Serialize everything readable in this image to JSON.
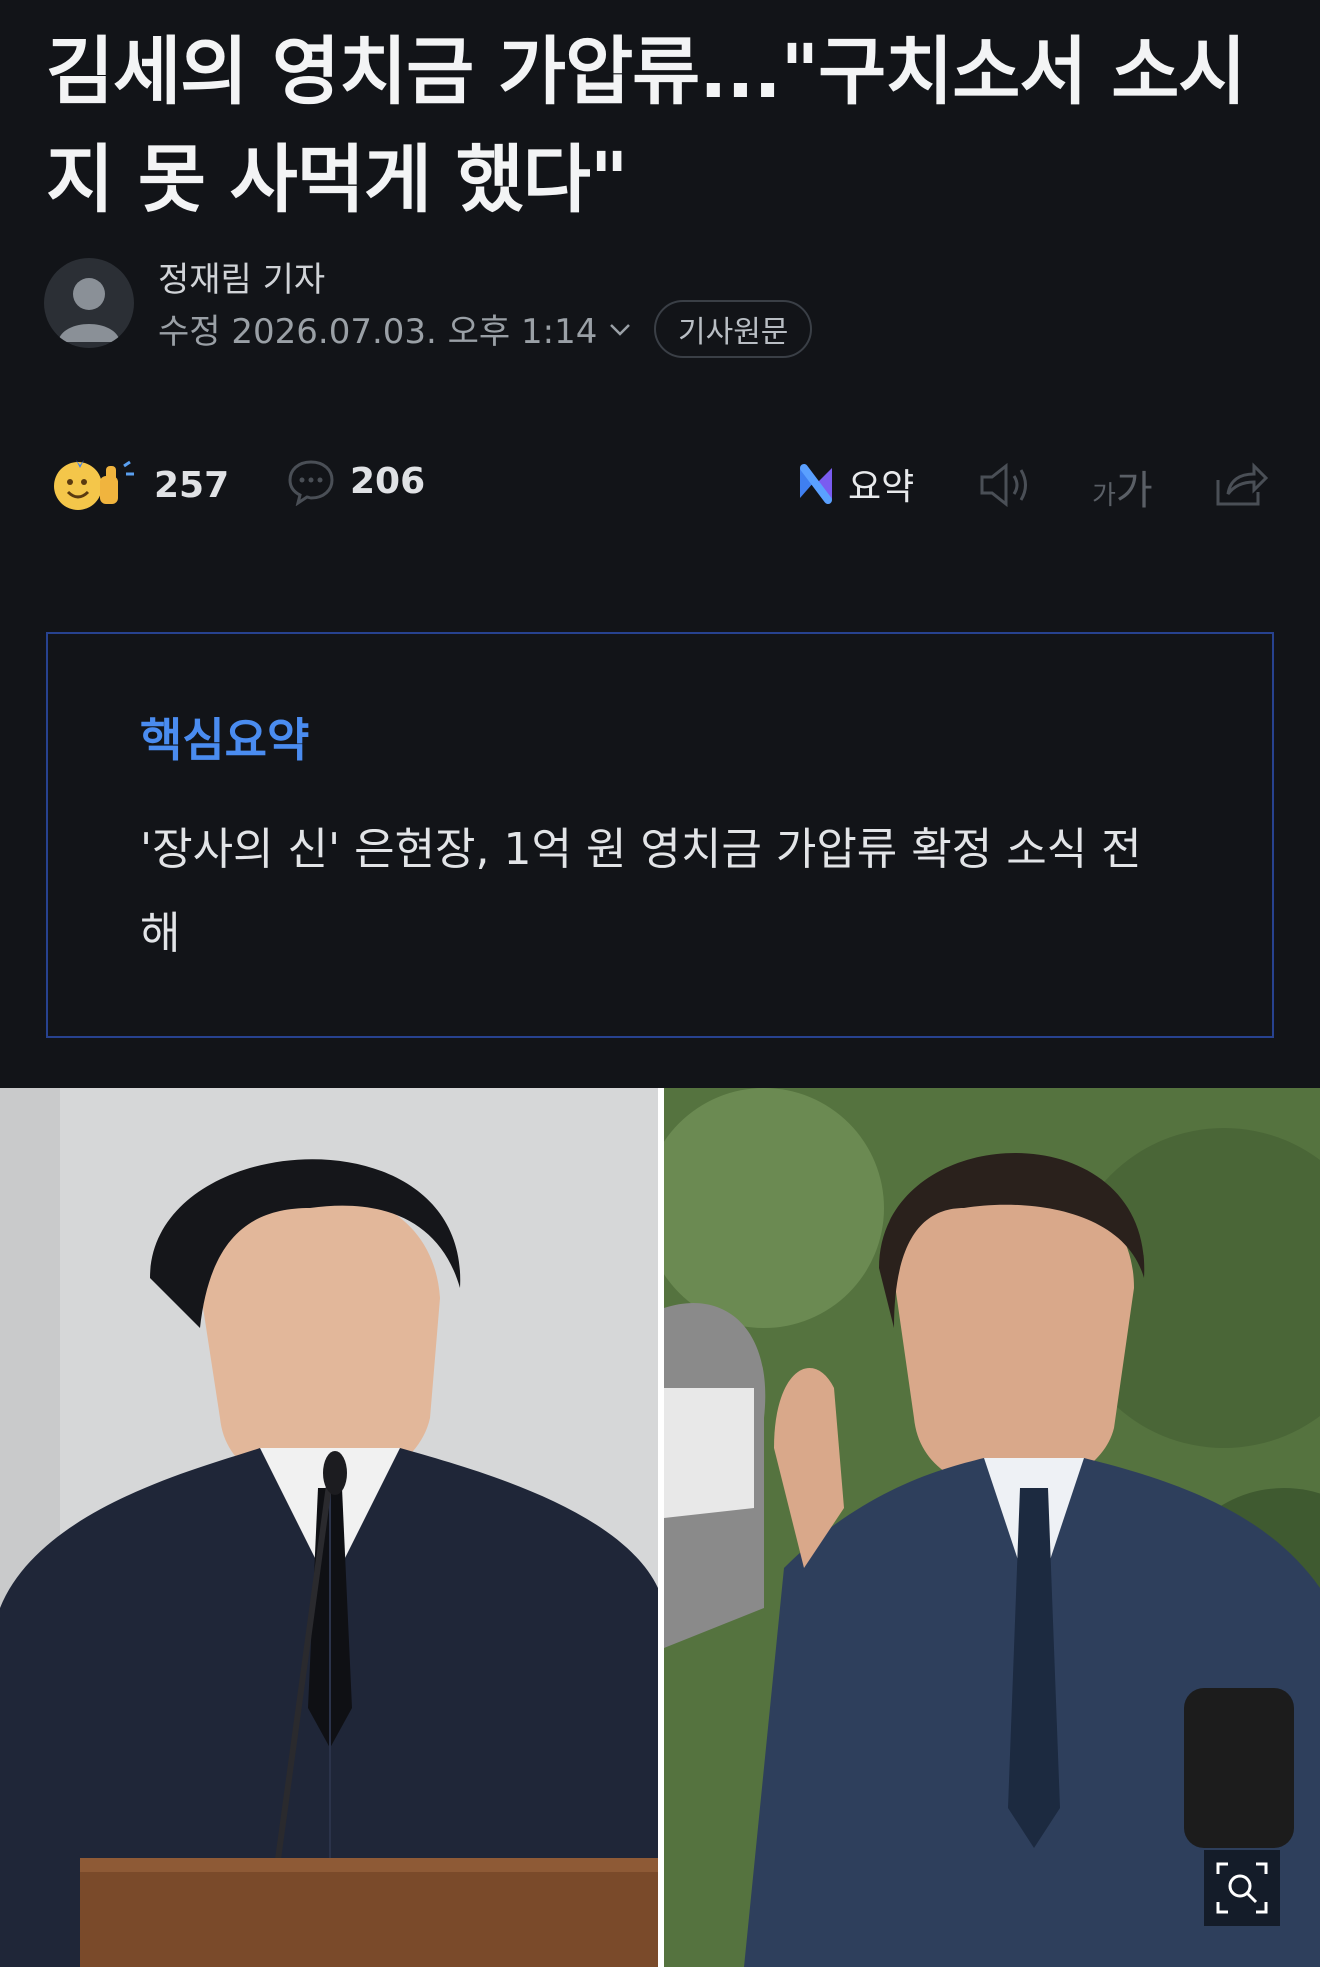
{
  "article": {
    "headline": "김세의 영치금 가압류...\"구치소서 소시지 못 사먹게 했다\"",
    "reporter": "정재림 기자",
    "date_label": "수정 2026.07.03. 오후 1:14",
    "original_button": "기사원문"
  },
  "toolbar": {
    "reaction_count": "257",
    "comment_count": "206",
    "summary_label": "요약",
    "font_label_small": "가",
    "font_label_large": "가"
  },
  "summary": {
    "title": "핵심요약",
    "text": "'장사의 신' 은현장, 1억 원 영치금 가압류 확정 소식 전해"
  },
  "colors": {
    "background": "#121418",
    "accent_blue": "#4a8cf0",
    "box_border": "#27428f"
  },
  "icons": [
    "avatar-icon",
    "chevron-down-icon",
    "reaction-emoji-icon",
    "comment-icon",
    "ai-summary-icon",
    "speaker-icon",
    "font-size-icon",
    "share-icon",
    "zoom-icon"
  ]
}
